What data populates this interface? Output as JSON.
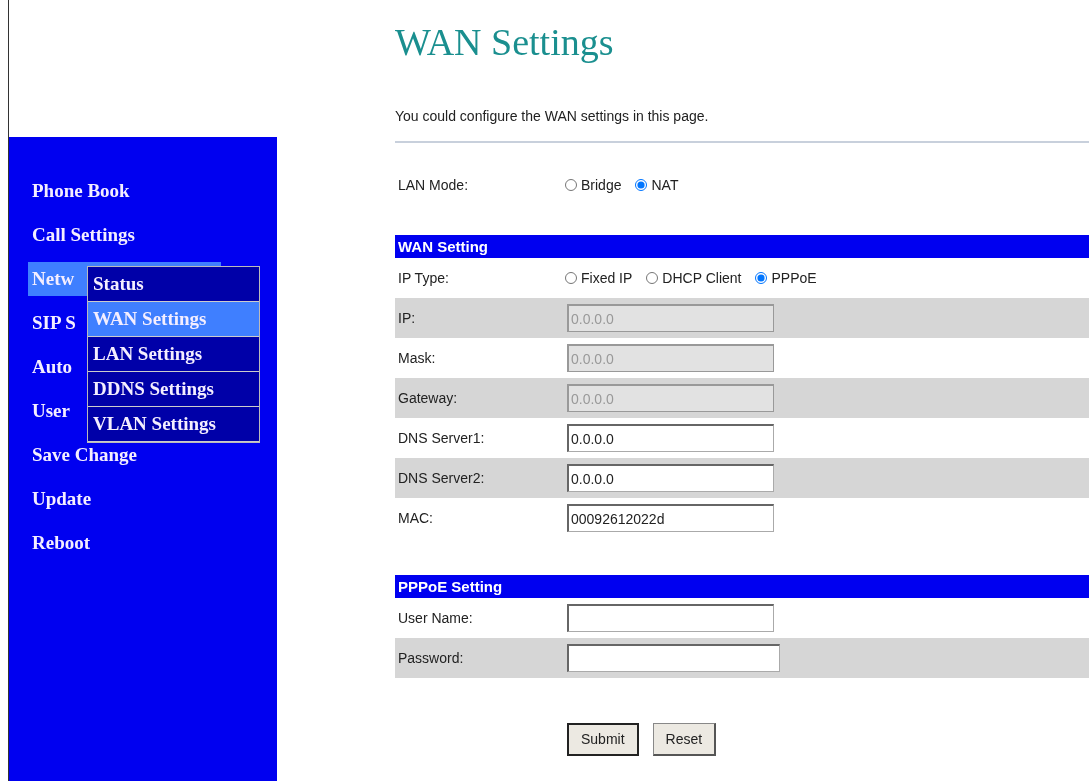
{
  "sidebar": {
    "items": [
      {
        "label": "Phone Book",
        "selected": false
      },
      {
        "label": "Call Settings",
        "selected": false
      },
      {
        "label": "Netw",
        "selected": true
      },
      {
        "label": "SIP S",
        "selected": false
      },
      {
        "label": "Auto",
        "selected": false
      },
      {
        "label": "User",
        "selected": false
      },
      {
        "label": "Save Change",
        "selected": false
      },
      {
        "label": "Update",
        "selected": false
      },
      {
        "label": "Reboot",
        "selected": false
      }
    ],
    "submenu": [
      {
        "label": "Status",
        "selected": false
      },
      {
        "label": "WAN Settings",
        "selected": true
      },
      {
        "label": "LAN Settings",
        "selected": false
      },
      {
        "label": "DDNS Settings",
        "selected": false
      },
      {
        "label": "VLAN Settings",
        "selected": false
      }
    ]
  },
  "page": {
    "title": "WAN Settings",
    "description": "You could configure the WAN settings in this page.",
    "lan_mode": {
      "label": "LAN Mode:",
      "options": [
        {
          "label": "Bridge",
          "selected": false
        },
        {
          "label": "NAT",
          "selected": true
        }
      ]
    },
    "sections": [
      {
        "title": "WAN Setting",
        "rows": [
          {
            "kind": "radio",
            "label": "IP Type:",
            "options": [
              {
                "label": "Fixed IP",
                "selected": false
              },
              {
                "label": "DHCP Client",
                "selected": false
              },
              {
                "label": "PPPoE",
                "selected": true
              }
            ]
          },
          {
            "kind": "field",
            "label": "IP:",
            "value": "0.0.0.0",
            "disabled": true
          },
          {
            "kind": "field",
            "label": "Mask:",
            "value": "0.0.0.0",
            "disabled": true
          },
          {
            "kind": "field",
            "label": "Gateway:",
            "value": "0.0.0.0",
            "disabled": true
          },
          {
            "kind": "field",
            "label": "DNS Server1:",
            "value": "0.0.0.0",
            "disabled": false
          },
          {
            "kind": "field",
            "label": "DNS Server2:",
            "value": "0.0.0.0",
            "disabled": false
          },
          {
            "kind": "field",
            "label": "MAC:",
            "value": "00092612022d",
            "disabled": false
          }
        ]
      },
      {
        "title": "PPPoE Setting",
        "rows": [
          {
            "kind": "field",
            "label": "User Name:",
            "value": "",
            "disabled": false
          },
          {
            "kind": "password",
            "label": "Password:",
            "value": "",
            "disabled": false
          }
        ]
      }
    ],
    "buttons": [
      "Submit",
      "Reset"
    ]
  }
}
